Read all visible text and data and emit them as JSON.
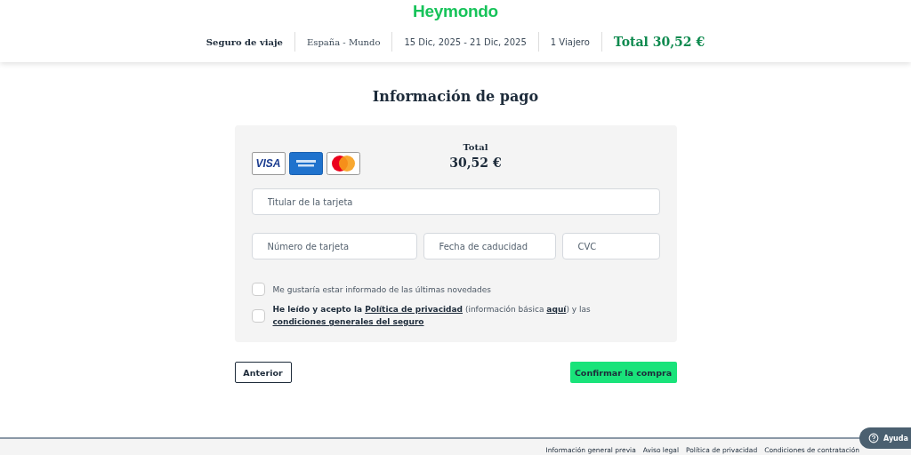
{
  "header": {
    "logo": "Heymondo",
    "summary": [
      "Seguro de viaje",
      "España - Mundo",
      "15 Dic, 2025 - 21 Dic, 2025",
      "1 Viajero"
    ],
    "total": "Total 30,52 €"
  },
  "title": "Información de pago",
  "payment": {
    "cards": [
      {
        "kind": "visa",
        "label": "VISA"
      },
      {
        "kind": "amex"
      },
      {
        "kind": "mastercard"
      }
    ],
    "total_label": "Total",
    "total_value": "30,52 €",
    "fields": [
      {
        "placeholder": "Titular de la tarjeta"
      },
      {
        "placeholder": "Número de tarjeta"
      },
      {
        "placeholder": "Fecha de caducidad"
      },
      {
        "placeholder": "CVC"
      }
    ],
    "consents": [
      {
        "checked": false,
        "parts": [
          {
            "kind": "plain",
            "text": "Me gustaría estar informado de las últimas novedades"
          }
        ]
      },
      {
        "checked": false,
        "parts": [
          {
            "kind": "bold",
            "text": "He leído y acepto la "
          },
          {
            "kind": "link",
            "text": "Política de privacidad"
          },
          {
            "kind": "plain",
            "text": " (información básica "
          },
          {
            "kind": "link",
            "text": "aquí"
          },
          {
            "kind": "plain",
            "text": ") y las "
          },
          {
            "kind": "link",
            "text": "condiciones generales del seguro"
          }
        ]
      }
    ]
  },
  "buttons": {
    "back": "Anterior",
    "confirm": "Confirmar la compra"
  },
  "footer": {
    "links": [
      "Información general previa",
      "Aviso legal",
      "Política de privacidad",
      "Condiciones de contratación"
    ]
  },
  "help": {
    "label": "Ayuda"
  }
}
